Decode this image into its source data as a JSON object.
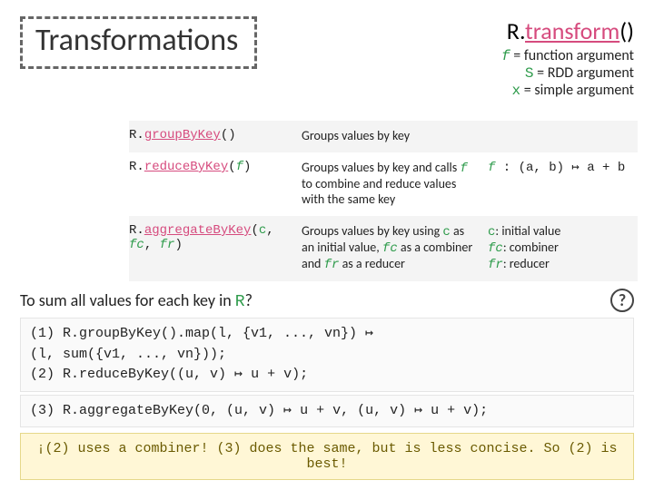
{
  "title": "Transformations",
  "legend": {
    "api_r": "R.",
    "api_fn": "transform",
    "api_paren": "()",
    "line_f_var": "f",
    "line_f_desc": " = function argument",
    "line_s_var": "S",
    "line_s_desc": " = RDD argument",
    "line_x_var": "x",
    "line_x_desc": " = simple argument"
  },
  "rows": [
    {
      "api_pre": "R.",
      "api_fn": "groupByKey",
      "api_args": "()",
      "desc": "Groups values by key",
      "extra": ""
    },
    {
      "api_pre": "R.",
      "api_fn": "reduceByKey",
      "api_args_open": "(",
      "api_argvar": "f",
      "api_args_close": ")",
      "desc_a": "Groups values by key and calls ",
      "desc_var": "f",
      "desc_b": " to combine and reduce values with the same key",
      "extra_a": "f",
      "extra_b": " : (a, b) ↦ a + b"
    },
    {
      "api_pre": "R.",
      "api_fn": "aggregateByKey",
      "api_args_open": "(",
      "api_arg1": "c",
      "api_sep1": ", ",
      "api_arg2": "fc",
      "api_sep2": ", ",
      "api_arg3": "fr",
      "api_args_close": ")",
      "desc_a": "Groups values by key using ",
      "desc_v1": "c",
      "desc_b": " as an initial value, ",
      "desc_v2": "fc",
      "desc_c": " as a combiner and ",
      "desc_v3": "fr",
      "desc_d": " as a reducer",
      "e1a": "c",
      "e1b": ": initial value",
      "e2a": "fc",
      "e2b": ": combiner",
      "e3a": "fr",
      "e3b": ": reducer"
    }
  ],
  "question": {
    "text_a": "To sum all values for each key in ",
    "text_r": "R",
    "text_b": "?",
    "glyph": "?"
  },
  "code1": "(1) R.groupByKey().map(l, {v1, ..., vn}) ↦\n(l, sum({v1, ..., vn}));\n(2) R.reduceByKey((u, v) ↦ u + v);",
  "code2": "(3) R.aggregateByKey(0, (u, v) ↦ u + v, (u, v) ↦ u + v);",
  "answer": "¡(2) uses a combiner! (3) does the same, but is less concise. So (2) is best!"
}
